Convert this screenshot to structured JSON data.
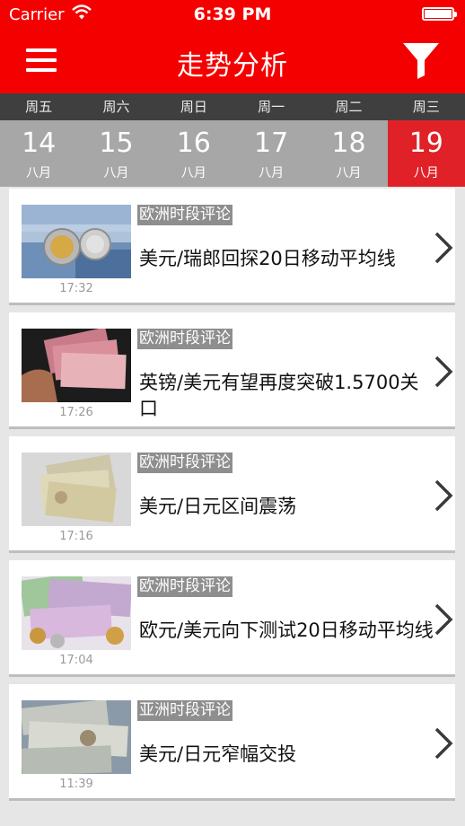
{
  "status_bar": {
    "carrier": "Carrier",
    "time": "6:39 PM"
  },
  "nav": {
    "title": "走势分析"
  },
  "calendar": {
    "days": [
      {
        "weekday": "周五",
        "date": "14",
        "month": "八月",
        "active": false
      },
      {
        "weekday": "周六",
        "date": "15",
        "month": "八月",
        "active": false
      },
      {
        "weekday": "周日",
        "date": "16",
        "month": "八月",
        "active": false
      },
      {
        "weekday": "周一",
        "date": "17",
        "month": "八月",
        "active": false
      },
      {
        "weekday": "周二",
        "date": "18",
        "month": "八月",
        "active": false
      },
      {
        "weekday": "周三",
        "date": "19",
        "month": "八月",
        "active": true
      }
    ]
  },
  "articles": [
    {
      "category": "欧洲时段评论",
      "title": "美元/瑞郎回探20日移动平均线",
      "time": "17:32",
      "image": "coins-on-banknotes"
    },
    {
      "category": "欧洲时段评论",
      "title": "英镑/美元有望再度突破1.5700关口",
      "time": "17:26",
      "image": "hand-holding-pounds"
    },
    {
      "category": "欧洲时段评论",
      "title": "美元/日元区间震荡",
      "time": "17:16",
      "image": "yen-notes"
    },
    {
      "category": "欧洲时段评论",
      "title": "欧元/美元向下测试20日移动平均线",
      "time": "17:04",
      "image": "euro-notes-coins"
    },
    {
      "category": "亚洲时段评论",
      "title": "美元/日元窄幅交投",
      "time": "11:39",
      "image": "yen-bills"
    }
  ],
  "colors": {
    "accent": "#f40000",
    "active_date": "#e02128",
    "inactive_date": "#a7a7a7",
    "weekday_bar": "#3f3f3f",
    "tag_bg": "#8e8e8e"
  }
}
